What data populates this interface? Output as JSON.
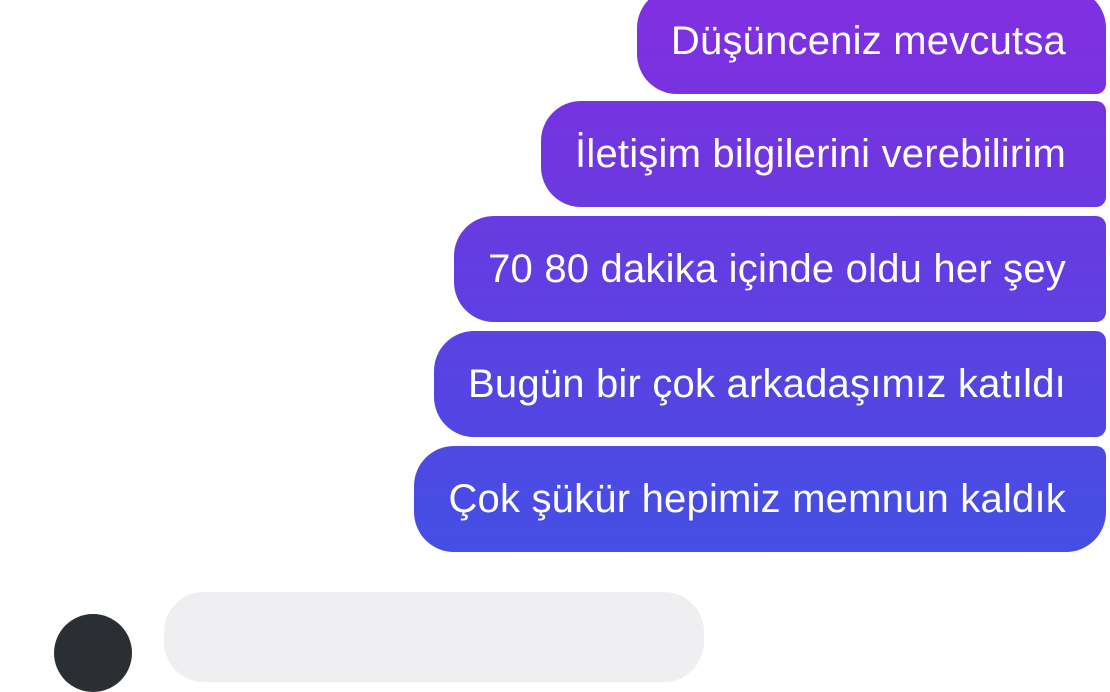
{
  "conversation": {
    "messages": [
      {
        "text": "Düşünceniz mevcutsa",
        "color": "#7d2fe0"
      },
      {
        "text": "İletişim bilgilerini verebilirim",
        "color": "#7334e0"
      },
      {
        "text": "70 80 dakika içinde oldu her şey",
        "color": "#653ce1"
      },
      {
        "text": "Bugün bir çok arkadaşımız katıldı",
        "color": "#5843e2"
      },
      {
        "text": "Çok şükür hepimiz memnun kaldık",
        "color": "#4a4ce3"
      }
    ],
    "incoming_bubble_color": "#efeff1",
    "avatar_color": "#2b2f33"
  }
}
